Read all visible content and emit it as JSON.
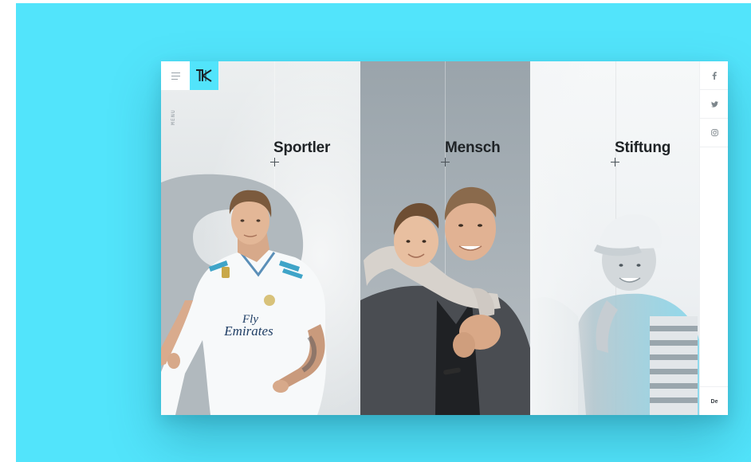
{
  "header": {
    "menu_label": "MENÜ",
    "logo_text": "TK"
  },
  "panels": [
    {
      "title": "Sportler",
      "background_number": "8"
    },
    {
      "title": "Mensch"
    },
    {
      "title": "Stiftung"
    }
  ],
  "social": [
    {
      "label": "f",
      "icon": "facebook-icon"
    },
    {
      "label": "twitter",
      "icon": "twitter-icon"
    },
    {
      "label": "instagram",
      "icon": "instagram-icon"
    }
  ],
  "language": "De",
  "jersey": {
    "sponsor_line1": "Fly",
    "sponsor_line2": "Emirates"
  },
  "colors": {
    "accent": "#52e4fb",
    "title_text": "#1f2326",
    "panel_1_bg": "#e4e8ea",
    "panel_2_bg": "#a4adb3",
    "panel_3_bg": "#f1f4f6"
  }
}
